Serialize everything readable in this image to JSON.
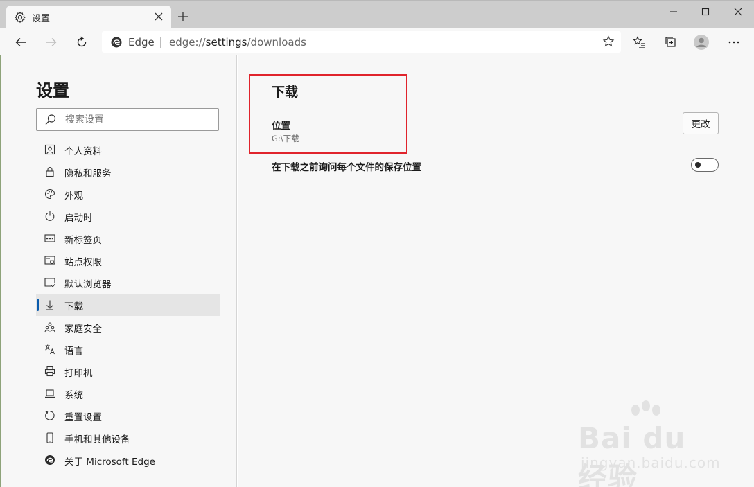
{
  "tab": {
    "title": "设置"
  },
  "address": {
    "site_label": "Edge",
    "url_prefix": "edge://",
    "url_strong": "settings",
    "url_suffix": "/downloads"
  },
  "sidebar": {
    "title": "设置",
    "search_placeholder": "搜索设置",
    "items": [
      {
        "label": "个人资料",
        "icon": "profile-icon"
      },
      {
        "label": "隐私和服务",
        "icon": "lock-icon"
      },
      {
        "label": "外观",
        "icon": "palette-icon"
      },
      {
        "label": "启动时",
        "icon": "power-icon"
      },
      {
        "label": "新标签页",
        "icon": "new-tab-page-icon"
      },
      {
        "label": "站点权限",
        "icon": "site-permissions-icon"
      },
      {
        "label": "默认浏览器",
        "icon": "default-browser-icon"
      },
      {
        "label": "下载",
        "icon": "download-icon",
        "active": true
      },
      {
        "label": "家庭安全",
        "icon": "family-icon"
      },
      {
        "label": "语言",
        "icon": "language-icon"
      },
      {
        "label": "打印机",
        "icon": "printer-icon"
      },
      {
        "label": "系统",
        "icon": "laptop-icon"
      },
      {
        "label": "重置设置",
        "icon": "reset-icon"
      },
      {
        "label": "手机和其他设备",
        "icon": "phone-icon"
      },
      {
        "label": "关于 Microsoft Edge",
        "icon": "edge-logo-icon"
      }
    ]
  },
  "downloads": {
    "title": "下载",
    "location_label": "位置",
    "location_value": "G:\\下载",
    "change_button": "更改",
    "ask_label": "在下载之前询问每个文件的保存位置",
    "ask_enabled": false
  },
  "watermark": {
    "main": "Bai du 经验",
    "sub": "jingyan.baidu.com"
  },
  "colors": {
    "accent": "#0b5cad",
    "highlight": "#e0242c"
  }
}
